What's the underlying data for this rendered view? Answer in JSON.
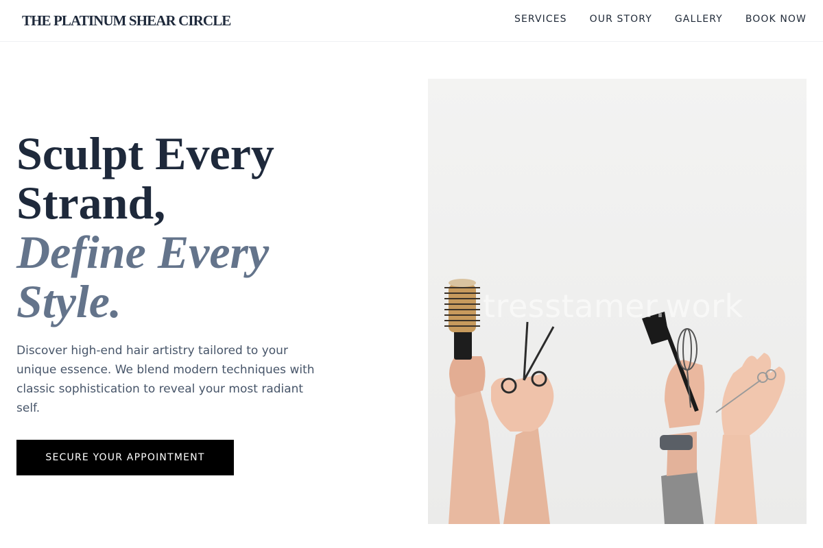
{
  "header": {
    "brand": "THE PLATINUM SHEAR CIRCLE",
    "nav": [
      "SERVICES",
      "OUR STORY",
      "GALLERY",
      "BOOK NOW"
    ]
  },
  "hero": {
    "headline_line1": "Sculpt Every",
    "headline_line2": "Strand,",
    "headline_accent_line1": "Define Every",
    "headline_accent_line2": "Style.",
    "description": "Discover high-end hair artistry tailored to your unique essence. We blend modern techniques with classic sophistication to reveal your most radiant self.",
    "cta_label": "SECURE YOUR APPOINTMENT",
    "image_watermark": "tresstamer.work"
  },
  "colors": {
    "heading": "#1e293b",
    "accent": "#64748b",
    "cta_background": "#000000"
  }
}
